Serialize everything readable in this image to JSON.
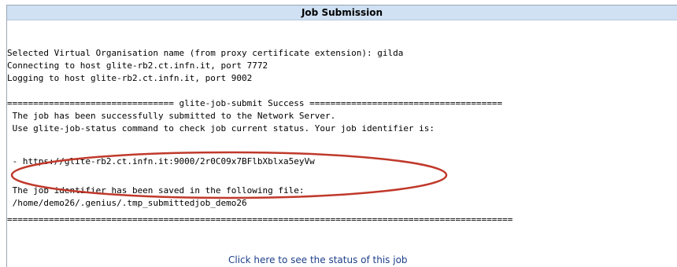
{
  "header": {
    "title": "Job Submission"
  },
  "output": {
    "lines": [
      "Selected Virtual Organisation name (from proxy certificate extension): gilda",
      "Connecting to host glite-rb2.ct.infn.it, port 7772",
      "Logging to host glite-rb2.ct.infn.it, port 9002",
      "================================ glite-job-submit Success =====================================",
      " The job has been successfully submitted to the Network Server.",
      " Use glite-job-status command to check job current status. Your job identifier is:",
      " - https://glite-rb2.ct.infn.it:9000/2r0C09x7BFlbXblxa5eyVw",
      " The job identifier has been saved in the following file:",
      " /home/demo26/.genius/.tmp_submittedjob_demo26",
      "================================================================================================="
    ]
  },
  "footer": {
    "status_link": "Click here to see the status of this job"
  },
  "colors": {
    "header_bg": "#cfe1f3",
    "highlight": "#c0392b",
    "link": "#1e3f8a"
  }
}
